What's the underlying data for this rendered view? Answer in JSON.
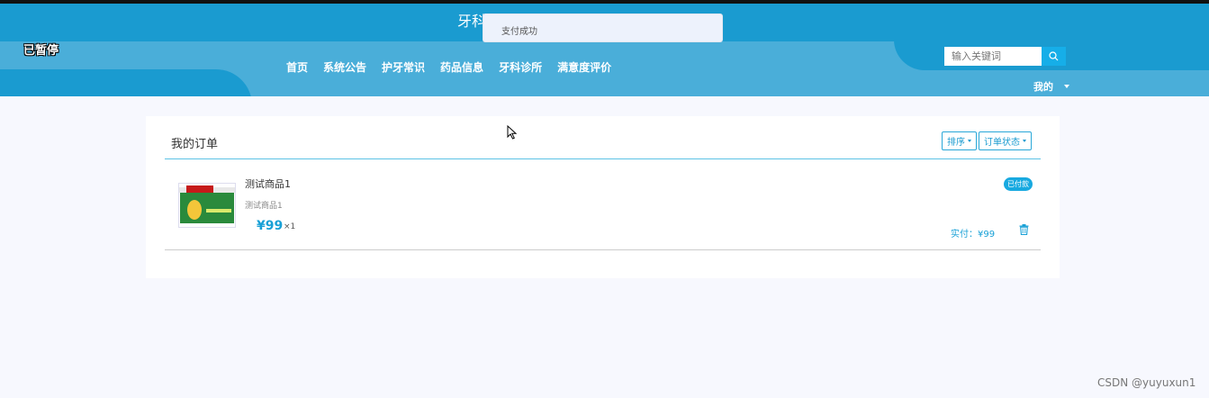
{
  "header": {
    "site_title": "牙科",
    "paused_label": "已暂停",
    "nav": [
      "首页",
      "系统公告",
      "护牙常识",
      "药品信息",
      "牙科诊所",
      "满意度评价"
    ],
    "search_placeholder": "输入关键词",
    "mine_label": "我的"
  },
  "toast": {
    "message": "支付成功"
  },
  "orders": {
    "title": "我的订单",
    "sort_label": "排序",
    "status_filter_label": "订单状态",
    "item": {
      "name": "测试商品1",
      "subtitle": "测试商品1",
      "price": "¥99",
      "quantity": "×1",
      "status": "已付款",
      "actual_paid": "实付：¥99"
    }
  },
  "watermark": "CSDN @yuyuxun1",
  "colors": {
    "header_dark": "#1a9bd0",
    "header_light": "#4aaed9",
    "accent": "#18a0d6",
    "page_bg": "#f7f8fe"
  }
}
